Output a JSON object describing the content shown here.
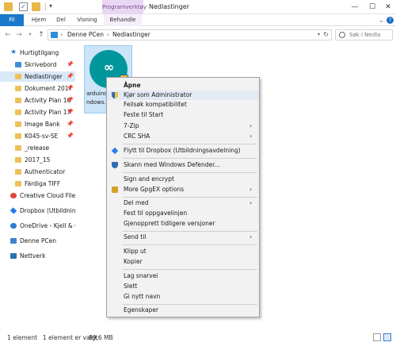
{
  "window": {
    "contextual_tab": "Programverktøy",
    "title": "Nedlastinger",
    "min": "—",
    "max": "☐",
    "close": "✕"
  },
  "ribbon": {
    "tabs": [
      {
        "label": "Fil"
      },
      {
        "label": "Hjem"
      },
      {
        "label": "Del"
      },
      {
        "label": "Visning"
      },
      {
        "label": "Behandle"
      }
    ],
    "caret": "⌄",
    "help": "?"
  },
  "address": {
    "back": "←",
    "forward": "→",
    "down": "▾",
    "up": "↑",
    "sep0": "›",
    "crumbs": [
      "Denne PCen",
      "Nedlastinger"
    ],
    "sep": "›",
    "dropdown": "▾",
    "refresh": "↻",
    "search_placeholder": "Søk i Nedla"
  },
  "sidebar": {
    "items": [
      {
        "label": "Hurtigtilgang",
        "icon": "star-icon",
        "pinned": false
      },
      {
        "label": "Skrivebord",
        "icon": "desktop-icon",
        "pinned": true
      },
      {
        "label": "Nedlastinger",
        "icon": "download-icon",
        "pinned": true
      },
      {
        "label": "Dokument 2017",
        "icon": "folder-icon",
        "pinned": true
      },
      {
        "label": "Activity Plan 16",
        "icon": "folder-icon",
        "pinned": true
      },
      {
        "label": "Activity Plan 17",
        "icon": "folder-icon",
        "pinned": true
      },
      {
        "label": "Image Bank",
        "icon": "folder-icon",
        "pinned": true
      },
      {
        "label": "K045-sv-SE",
        "icon": "folder-icon",
        "pinned": true
      },
      {
        "label": "_release",
        "icon": "folder-icon",
        "pinned": false
      },
      {
        "label": "2017_15",
        "icon": "folder-icon",
        "pinned": false
      },
      {
        "label": "Authenticator",
        "icon": "folder-icon",
        "pinned": false
      },
      {
        "label": "Färdiga TIFF",
        "icon": "folder-icon",
        "pinned": false
      },
      {
        "label": "Creative Cloud Files",
        "icon": "creative-cloud-icon",
        "pinned": false
      },
      {
        "label": "Dropbox (Utbildnings",
        "icon": "dropbox-icon",
        "pinned": false
      },
      {
        "label": "OneDrive - Kjell & Co",
        "icon": "onedrive-icon",
        "pinned": false
      },
      {
        "label": "Denne PCen",
        "icon": "computer-icon",
        "pinned": false
      },
      {
        "label": "Nettverk",
        "icon": "network-icon",
        "pinned": false
      }
    ],
    "pin_glyph": "📌"
  },
  "file": {
    "name_line1": "arduino-",
    "name_line2": "ndows.e",
    "icon": "arduino-app-icon",
    "glyph": "∞"
  },
  "context_menu": {
    "items": [
      {
        "label": "Åpne",
        "bold": true
      },
      {
        "label": "Kjør som Administrator",
        "icon": "uac-shield-icon",
        "highlight": true
      },
      {
        "label": "Feilsøk kompatibilitet"
      },
      {
        "label": "Feste til Start"
      },
      {
        "label": "7-Zip",
        "submenu": true
      },
      {
        "label": "CRC SHA",
        "submenu": true
      },
      {
        "label": "Flytt til Dropbox (Utbildningsavdelning)",
        "icon": "dropbox-icon"
      },
      {
        "label": "Skann med Windows Defender...",
        "icon": "defender-icon"
      },
      {
        "label": "Sign and encrypt"
      },
      {
        "label": "More GpgEX options",
        "icon": "gpg-icon",
        "submenu": true
      },
      {
        "label": "Del med",
        "submenu": true
      },
      {
        "label": "Fest til oppgavelinjen"
      },
      {
        "label": "Gjenopprett tidligere versjoner"
      },
      {
        "label": "Send til",
        "submenu": true
      },
      {
        "label": "Klipp ut"
      },
      {
        "label": "Kopier"
      },
      {
        "label": "Lag snarvei"
      },
      {
        "label": "Slett"
      },
      {
        "label": "Gi nytt navn"
      },
      {
        "label": "Egenskaper"
      }
    ],
    "arrow": "›"
  },
  "status": {
    "count": "1 element",
    "selected": "1 element er valgt",
    "size": "89,6 MB"
  }
}
